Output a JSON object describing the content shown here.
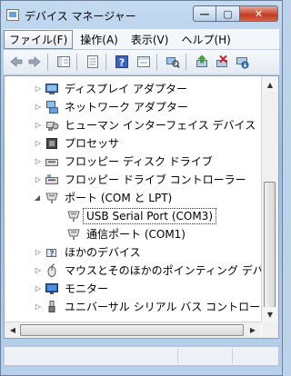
{
  "window": {
    "title": "デバイス マネージャー",
    "buttons": {
      "minimize": "—",
      "maximize": "▢",
      "close": "✕"
    }
  },
  "menu": [
    {
      "label": "ファイル(F)",
      "active": true
    },
    {
      "label": "操作(A)"
    },
    {
      "label": "表示(V)"
    },
    {
      "label": "ヘルプ(H)"
    }
  ],
  "toolbar": {
    "icons": [
      "back-arrow-icon",
      "forward-arrow-icon",
      "show-hide-tree-icon",
      "properties-icon",
      "help-icon",
      "action-pane-icon",
      "scan-hardware-icon",
      "update-driver-icon",
      "disable-device-icon",
      "uninstall-device-icon"
    ]
  },
  "tree": {
    "items": [
      {
        "label": "ディスプレイ アダプター",
        "icon": "display-adapter-icon",
        "expander": "collapsed"
      },
      {
        "label": "ネットワーク アダプター",
        "icon": "network-adapter-icon",
        "expander": "collapsed"
      },
      {
        "label": "ヒューマン インターフェイス デバイス",
        "icon": "hid-icon",
        "expander": "collapsed"
      },
      {
        "label": "プロセッサ",
        "icon": "processor-icon",
        "expander": "collapsed"
      },
      {
        "label": "フロッピー ディスク ドライブ",
        "icon": "floppy-drive-icon",
        "expander": "collapsed"
      },
      {
        "label": "フロッピー ドライブ コントローラー",
        "icon": "floppy-controller-icon",
        "expander": "collapsed"
      },
      {
        "label": "ポート (COM と LPT)",
        "icon": "port-icon",
        "expander": "expanded"
      },
      {
        "label": "USB Serial Port (COM3)",
        "icon": "port-icon",
        "child": true,
        "selected": true
      },
      {
        "label": "通信ポート (COM1)",
        "icon": "port-icon",
        "child": true
      },
      {
        "label": "ほかのデバイス",
        "icon": "other-device-icon",
        "expander": "collapsed"
      },
      {
        "label": "マウスとそのほかのポインティング デバイス",
        "icon": "mouse-icon",
        "expander": "collapsed"
      },
      {
        "label": "モニター",
        "icon": "monitor-icon",
        "expander": "collapsed"
      },
      {
        "label": "ユニバーサル シリアル バス コントローラー",
        "icon": "usb-icon",
        "expander": "collapsed"
      }
    ]
  },
  "colors": {
    "accent": "#3a6ea5",
    "selection_border": "#333333"
  }
}
